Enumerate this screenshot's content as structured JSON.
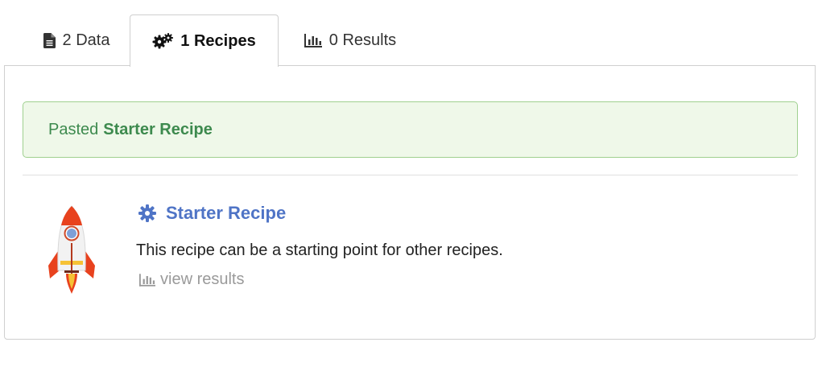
{
  "tabs": [
    {
      "count": "2",
      "label": "Data",
      "icon": "file-icon",
      "active": false
    },
    {
      "count": "1",
      "label": "Recipes",
      "icon": "gears-icon",
      "active": true
    },
    {
      "count": "0",
      "label": "Results",
      "icon": "bar-chart-icon",
      "active": false
    }
  ],
  "alert": {
    "prefix": "Pasted",
    "strong": "Starter Recipe",
    "colors": {
      "background": "#eff8e9",
      "border": "#9fd08f",
      "text": "#3d8a4e"
    }
  },
  "recipe": {
    "icon": "rocket-icon",
    "title": "Starter Recipe",
    "title_icon": "gear-icon",
    "description": "This recipe can be a starting point for other recipes.",
    "link_label": "view results",
    "link_icon": "bar-chart-icon"
  },
  "colors": {
    "accent": "#4f74c6",
    "muted": "#9a9a9a"
  }
}
